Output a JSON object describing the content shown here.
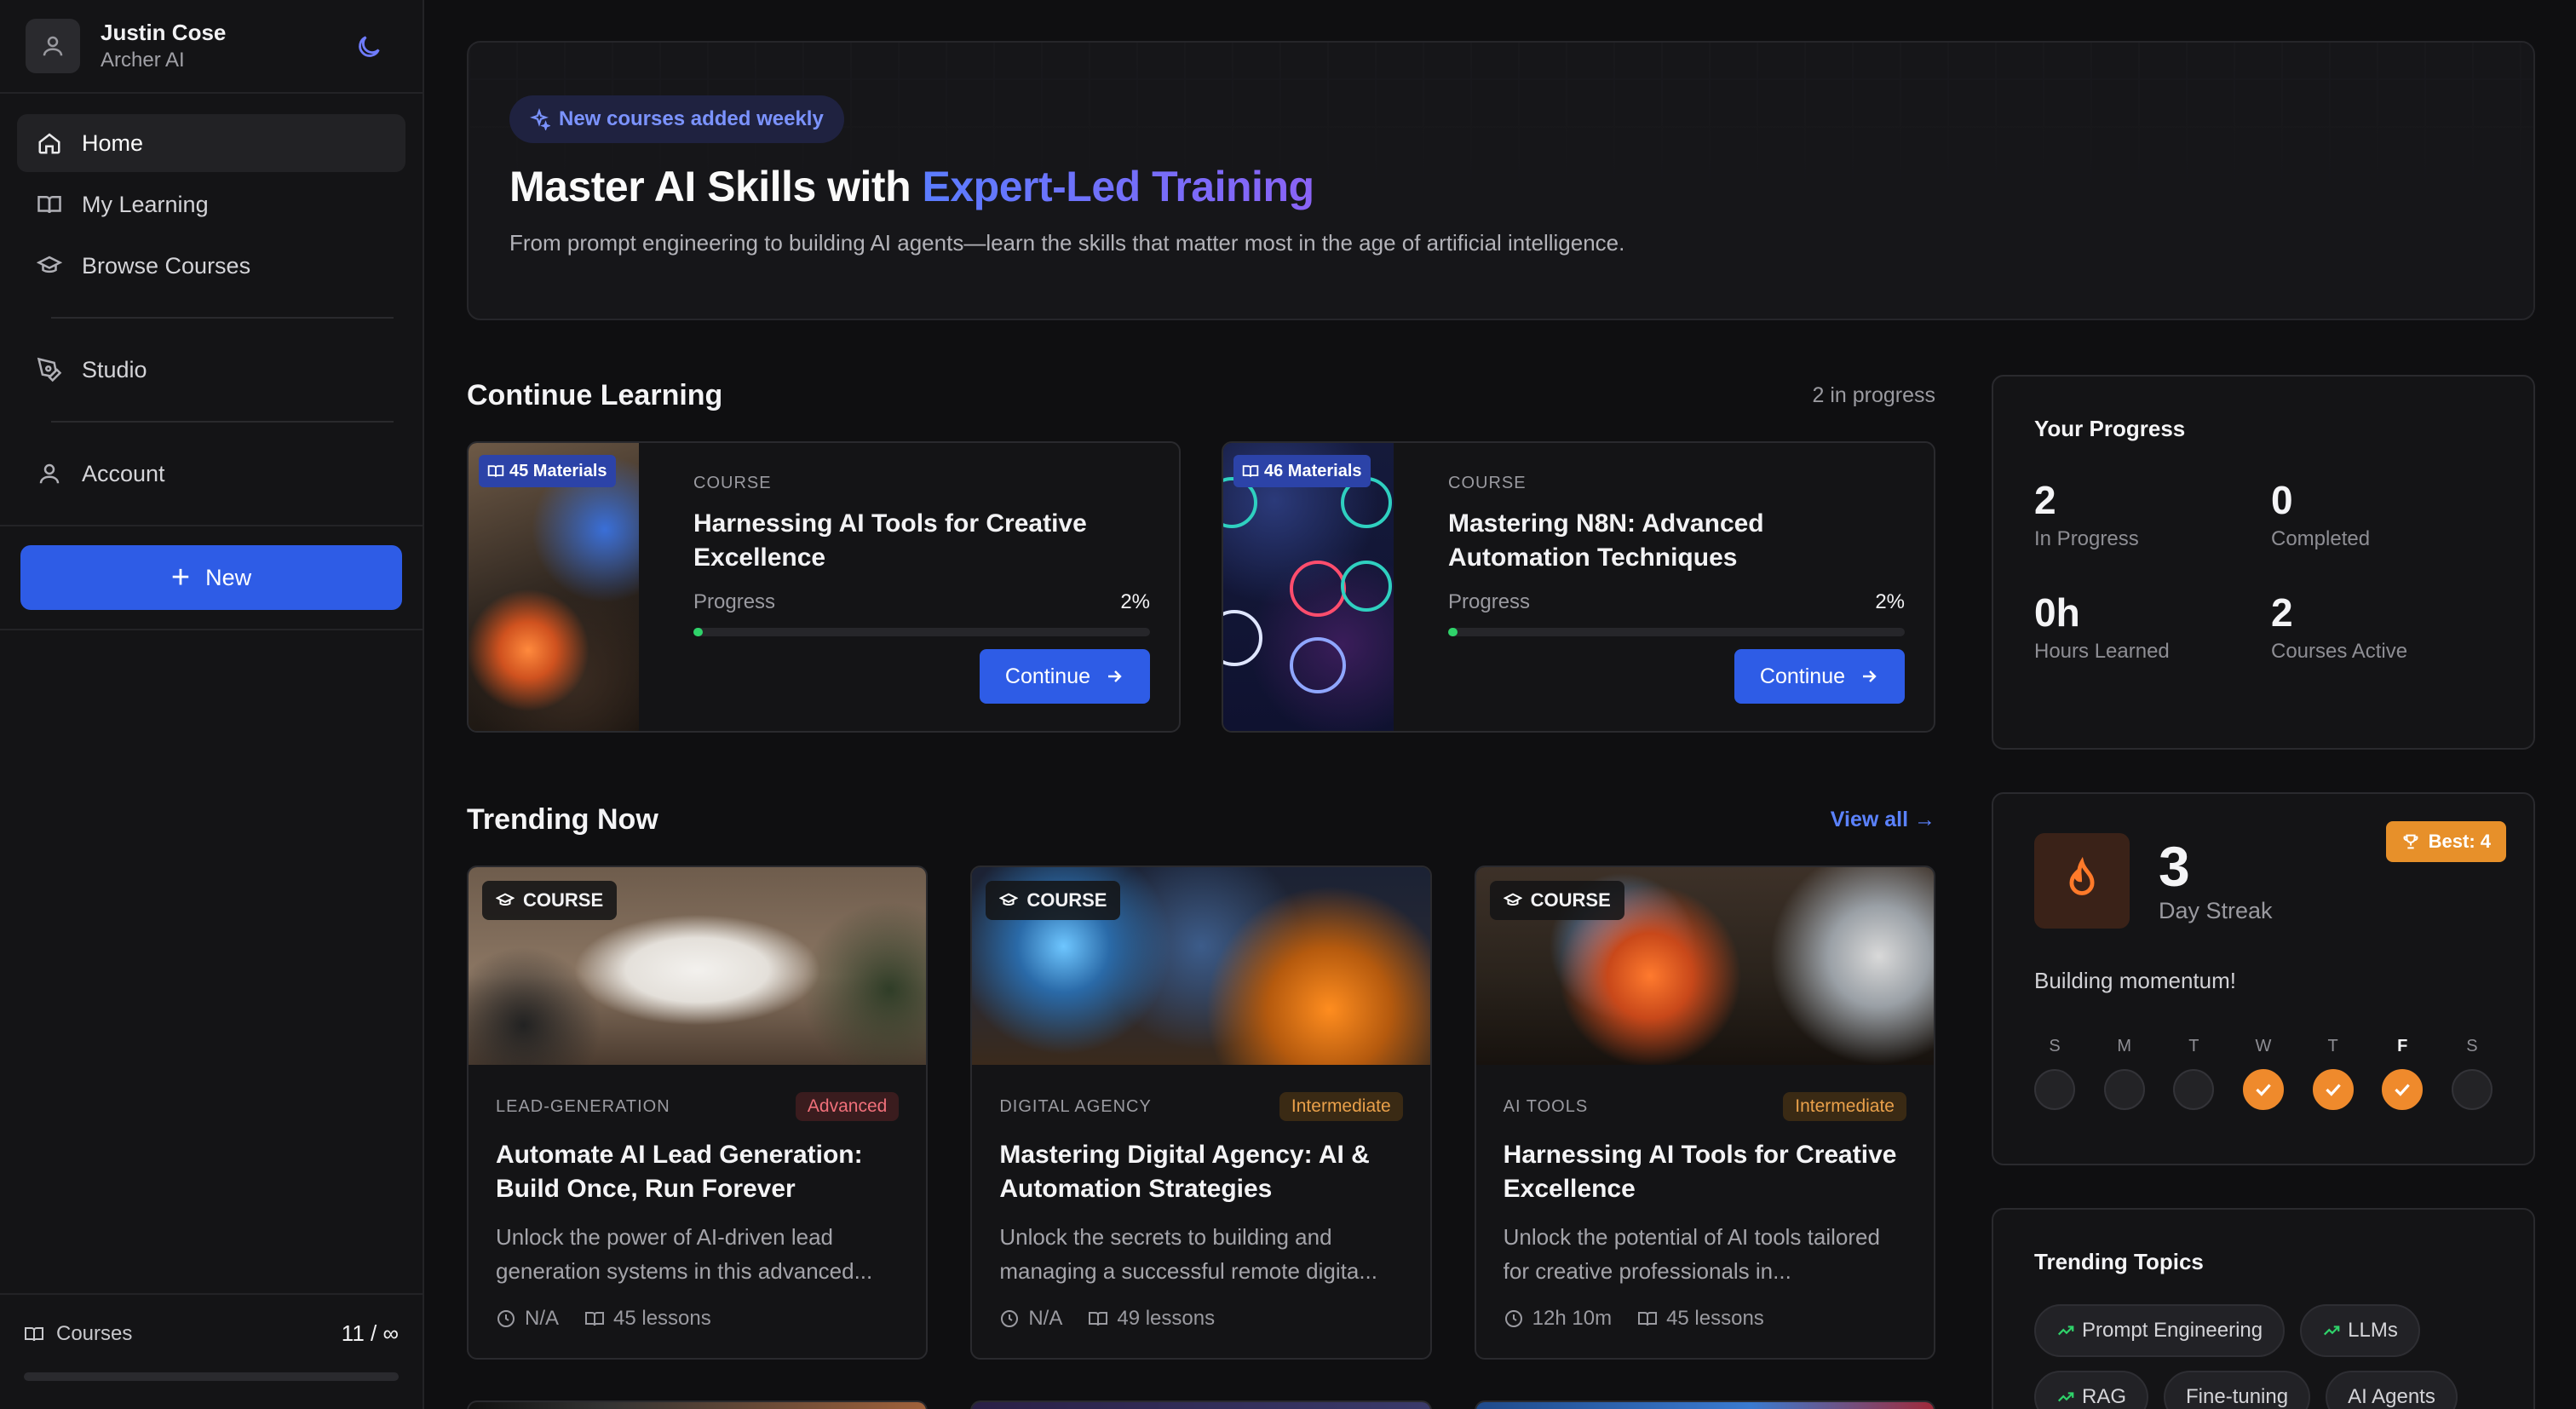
{
  "user": {
    "name": "Justin Cose",
    "org": "Archer AI"
  },
  "nav": {
    "home": "Home",
    "my_learning": "My Learning",
    "browse": "Browse Courses",
    "studio": "Studio",
    "account": "Account",
    "new_label": "New"
  },
  "footer": {
    "label": "Courses",
    "count": "11 / ∞"
  },
  "hero": {
    "badge": "New courses added weekly",
    "title_plain": "Master AI Skills with ",
    "title_accent": "Expert-Led Training",
    "subtitle": "From prompt engineering to building AI agents—learn the skills that matter most in the age of artificial intelligence."
  },
  "continue": {
    "title": "Continue Learning",
    "meta": "2 in progress",
    "progress_label": "Progress",
    "button": "Continue",
    "cards": [
      {
        "materials": "45 Materials",
        "type": "COURSE",
        "title": "Harnessing AI Tools for Creative Excellence",
        "percent_label": "2%",
        "progress": 0.02
      },
      {
        "materials": "46 Materials",
        "type": "COURSE",
        "title": "Mastering N8N: Advanced Automation Techniques",
        "percent_label": "2%",
        "progress": 0.02
      }
    ]
  },
  "trending": {
    "title": "Trending Now",
    "view_all": "View all →",
    "chip": "COURSE",
    "cards": [
      {
        "category": "LEAD-GENERATION",
        "level": "Advanced",
        "title": "Automate AI Lead Generation: Build Once, Run Forever",
        "desc": "Unlock the power of AI-driven lead generation systems in this advanced...",
        "duration": "N/A",
        "lessons": "45 lessons"
      },
      {
        "category": "DIGITAL AGENCY",
        "level": "Intermediate",
        "title": "Mastering Digital Agency: AI & Automation Strategies",
        "desc": "Unlock the secrets to building and managing a successful remote digita...",
        "duration": "N/A",
        "lessons": "49 lessons"
      },
      {
        "category": "AI TOOLS",
        "level": "Intermediate",
        "title": "Harnessing AI Tools for Creative Excellence",
        "desc": "Unlock the potential of AI tools tailored for creative professionals in...",
        "duration": "12h 10m",
        "lessons": "45 lessons"
      }
    ]
  },
  "progress": {
    "title": "Your Progress",
    "stats": [
      {
        "value": "2",
        "label": "In Progress"
      },
      {
        "value": "0",
        "label": "Completed"
      },
      {
        "value": "0h",
        "label": "Hours Learned"
      },
      {
        "value": "2",
        "label": "Courses Active"
      }
    ]
  },
  "streak": {
    "value": "3",
    "label": "Day Streak",
    "best": "Best: 4",
    "message": "Building momentum!",
    "days": [
      {
        "l": "S",
        "done": false
      },
      {
        "l": "M",
        "done": false
      },
      {
        "l": "T",
        "done": false
      },
      {
        "l": "W",
        "done": true
      },
      {
        "l": "T",
        "done": true
      },
      {
        "l": "F",
        "done": true
      },
      {
        "l": "S",
        "done": false
      }
    ]
  },
  "topics": {
    "title": "Trending Topics",
    "items": [
      "Prompt Engineering",
      "LLMs",
      "RAG",
      "Fine-tuning",
      "AI Agents"
    ]
  },
  "colors": {
    "accent": "#2e5ce6",
    "streak": "#ef8a2c",
    "progress": "#2fd36a"
  }
}
